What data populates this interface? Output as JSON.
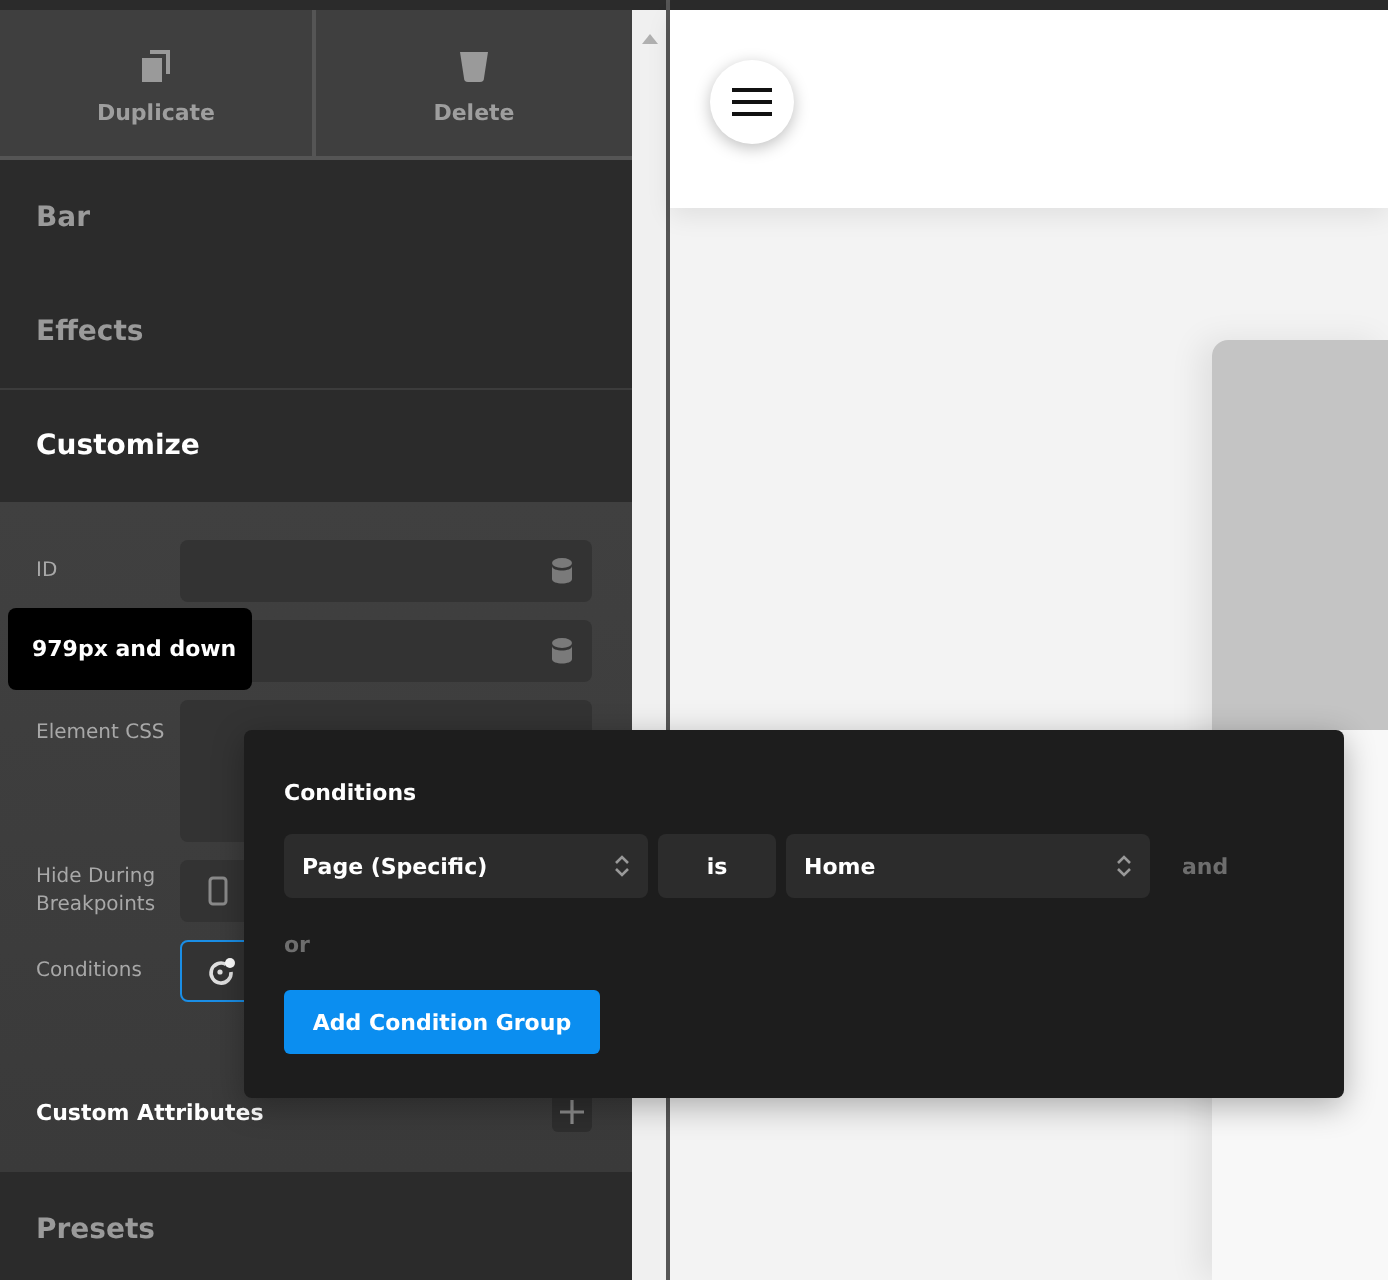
{
  "toolbar": {
    "buttons": [
      {
        "label": "Duplicate"
      },
      {
        "label": "Delete"
      }
    ]
  },
  "sections": [
    {
      "title": "Bar",
      "expanded": false
    },
    {
      "title": "Effects",
      "expanded": false
    },
    {
      "title": "Customize",
      "expanded": true
    },
    {
      "title": "Presets",
      "expanded": false
    }
  ],
  "customize": {
    "fields": [
      {
        "label": "ID",
        "kind": "text"
      },
      {
        "kind": "text"
      },
      {
        "label": "Element CSS",
        "kind": "textarea"
      },
      {
        "label": "Hide During Breakpoints",
        "kind": "breakpoints"
      },
      {
        "label": "Conditions",
        "kind": "conditions",
        "focused": true
      }
    ],
    "custom_attributes": "Custom Attributes"
  },
  "tooltip": "979px and down",
  "conditions_popover": {
    "title": "Conditions",
    "rule": {
      "subject": "Page (Specific)",
      "operator": "is",
      "value": "Home",
      "joiner": "and"
    },
    "or_label": "or",
    "add_button": "Add Condition Group"
  }
}
